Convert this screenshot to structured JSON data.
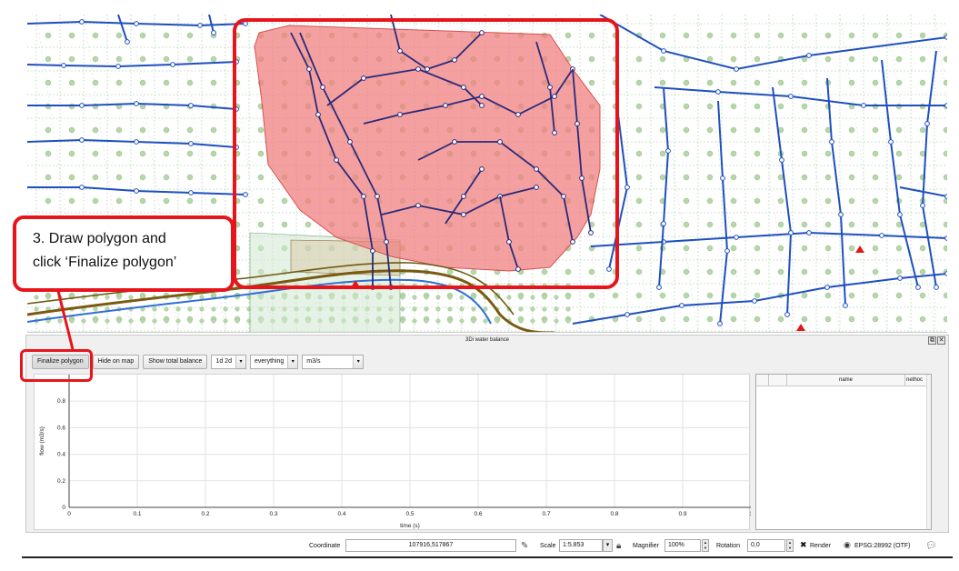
{
  "dock": {
    "title": "3Di water balance",
    "float_icon": "float-icon",
    "close_icon": "close-icon"
  },
  "toolbar": {
    "finalize_label": "Finalize polygon",
    "hide_label": "Hide on map",
    "total_label": "Show total balance",
    "combo_1d2d": "1d 2d",
    "combo_everything": "everything",
    "combo_units": "m3/s"
  },
  "chart_data": {
    "type": "line",
    "series": [],
    "xlabel": "time (s)",
    "ylabel": "flow (m3/s)",
    "xlim": [
      0,
      1
    ],
    "ylim": [
      0,
      1
    ],
    "x_ticks": [
      "0",
      "0.1",
      "0.2",
      "0.3",
      "0.4",
      "0.5",
      "0.6",
      "0.7",
      "0.8",
      "0.9",
      "1"
    ],
    "y_ticks": [
      "0",
      "0.2",
      "0.4",
      "0.6",
      "0.8"
    ],
    "grid": true
  },
  "table": {
    "columns": [
      "",
      "",
      "name",
      "nethoc"
    ]
  },
  "statusbar": {
    "coordinate_label": "Coordinate",
    "coordinate_value": "107916,517867",
    "scale_label": "Scale",
    "scale_value": "1:5.853",
    "magnifier_label": "Magnifier",
    "magnifier_value": "100%",
    "rotation_label": "Rotation",
    "rotation_value": "0,0",
    "render_label": "Render",
    "crs_label": "EPSG:28992 (OTF)"
  },
  "callout": {
    "line1": "3. Draw polygon and",
    "line2": "click ‘Finalize polygon’",
    "accent": "#e8141c"
  },
  "map_colors": {
    "polygon_fill": "#f08080",
    "channel": "#1f4fbf",
    "channel_dark": "#2a2a7a",
    "grid_node": "#b6d7a8"
  }
}
